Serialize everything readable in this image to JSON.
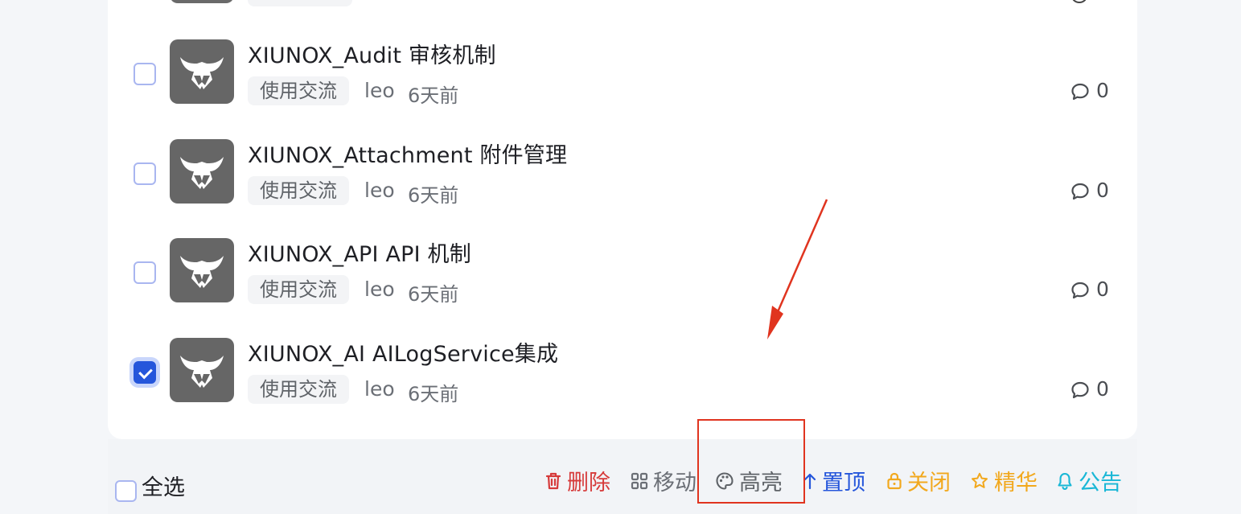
{
  "topics": [
    {
      "title": "XIUNOX_Audit 审核机制",
      "category": "使用交流",
      "author": "leo",
      "time": "6天前",
      "comment_count": "0",
      "checked": false
    },
    {
      "title": "XIUNOX_Attachment 附件管理",
      "category": "使用交流",
      "author": "leo",
      "time": "6天前",
      "comment_count": "0",
      "checked": false
    },
    {
      "title": "XIUNOX_API API 机制",
      "category": "使用交流",
      "author": "leo",
      "time": "6天前",
      "comment_count": "0",
      "checked": false
    },
    {
      "title": "XIUNOX_AI AILogService集成",
      "category": "使用交流",
      "author": "leo",
      "time": "6天前",
      "comment_count": "0",
      "checked": true
    }
  ],
  "bulk_actions": {
    "select_all_label": "全选",
    "delete_label": "删除",
    "move_label": "移动",
    "highlight_label": "高亮",
    "sticky_label": "置顶",
    "close_label": "关闭",
    "digest_label": "精华",
    "announce_label": "公告"
  },
  "colors": {
    "delete": "#d63a3a",
    "move": "#6b6f76",
    "highlight": "#5f6368",
    "sticky": "#2556db",
    "close": "#f2a81d",
    "digest": "#f2a81d",
    "announce": "#19b7d6",
    "annotation": "#e0341f",
    "checkbox_checked": "#2556db"
  },
  "icons": {
    "avatar": "bull-head-logo",
    "comment": "chat-bubble-icon",
    "delete": "trash-icon",
    "move": "grid-icon",
    "highlight": "palette-icon",
    "sticky": "arrow-up-icon",
    "close": "lock-icon",
    "digest": "star-icon",
    "announce": "bell-icon"
  }
}
